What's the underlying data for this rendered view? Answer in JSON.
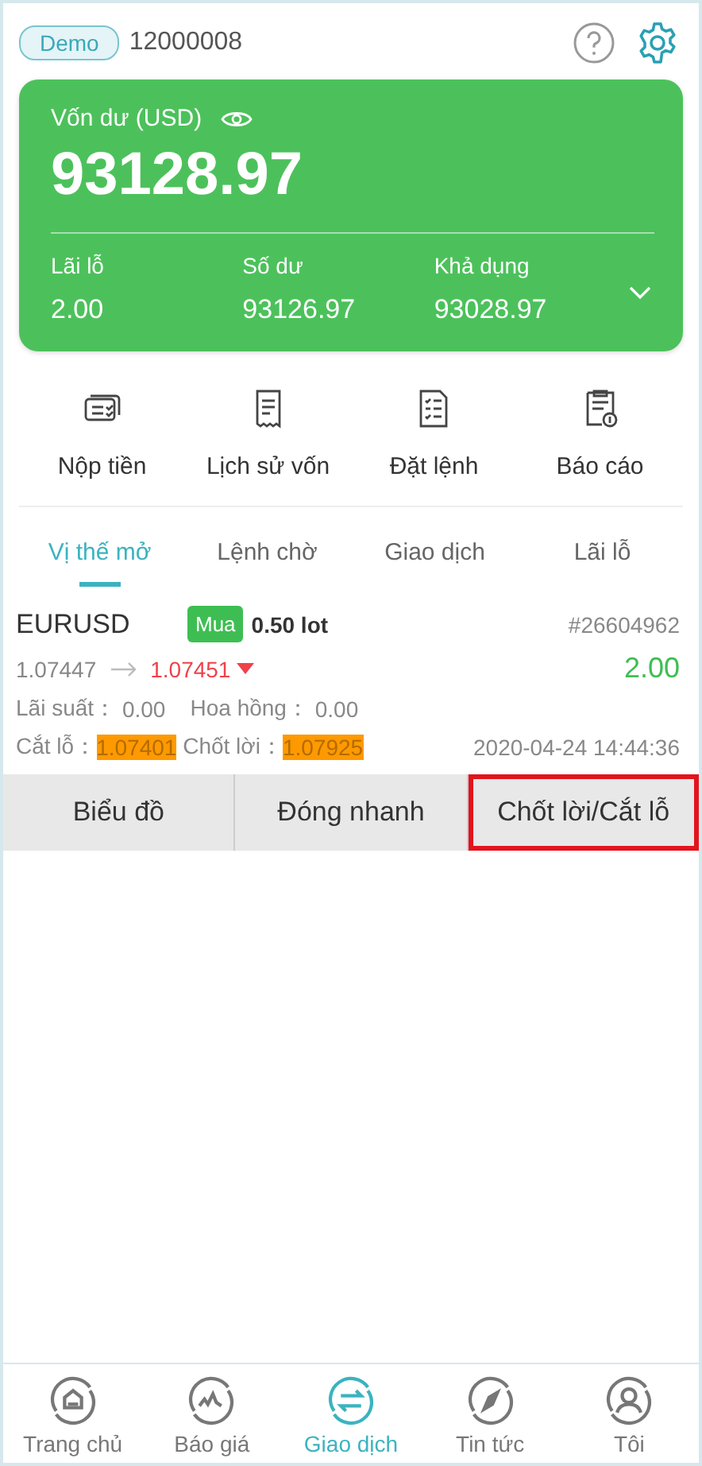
{
  "header": {
    "account_type": "Demo",
    "account_number": "12000008"
  },
  "balance_card": {
    "label": "Vốn dư (USD)",
    "amount": "93128.97",
    "stats": [
      {
        "label": "Lãi lỗ",
        "value": "2.00"
      },
      {
        "label": "Số dư",
        "value": "93126.97"
      },
      {
        "label": "Khả dụng",
        "value": "93028.97"
      }
    ]
  },
  "actions": [
    {
      "kind": "deposit",
      "label": "Nộp tiền"
    },
    {
      "kind": "history",
      "label": "Lịch sử vốn"
    },
    {
      "kind": "order",
      "label": "Đặt lệnh"
    },
    {
      "kind": "report",
      "label": "Báo cáo"
    }
  ],
  "tabs": [
    {
      "label": "Vị thế mở",
      "selected": true
    },
    {
      "label": "Lệnh chờ",
      "selected": false
    },
    {
      "label": "Giao dịch",
      "selected": false
    },
    {
      "label": "Lãi lỗ",
      "selected": false
    }
  ],
  "position": {
    "symbol": "EURUSD",
    "side": "Mua",
    "volume": "0.50 lot",
    "ticket": "#26604962",
    "open_price": "1.07447",
    "current_price": "1.07451",
    "profit": "2.00",
    "swap_label": "Lãi suất：",
    "swap": "0.00",
    "commission_label": "Hoa hồng：",
    "commission": "0.00",
    "sl_label": "Cắt lỗ：",
    "sl": "1.07401",
    "tp_label": "Chốt lời：",
    "tp": "1.07925",
    "time": "2020-04-24 14:44:36"
  },
  "position_buttons": [
    {
      "label": "Biểu đồ",
      "highlighted": false
    },
    {
      "label": "Đóng nhanh",
      "highlighted": false
    },
    {
      "label": "Chốt lời/Cắt lỗ",
      "highlighted": true
    }
  ],
  "bottom_nav": [
    {
      "kind": "home",
      "label": "Trang chủ",
      "selected": false
    },
    {
      "kind": "quotes",
      "label": "Báo giá",
      "selected": false
    },
    {
      "kind": "trade",
      "label": "Giao dịch",
      "selected": true
    },
    {
      "kind": "news",
      "label": "Tin tức",
      "selected": false
    },
    {
      "kind": "profile",
      "label": "Tôi",
      "selected": false
    }
  ]
}
